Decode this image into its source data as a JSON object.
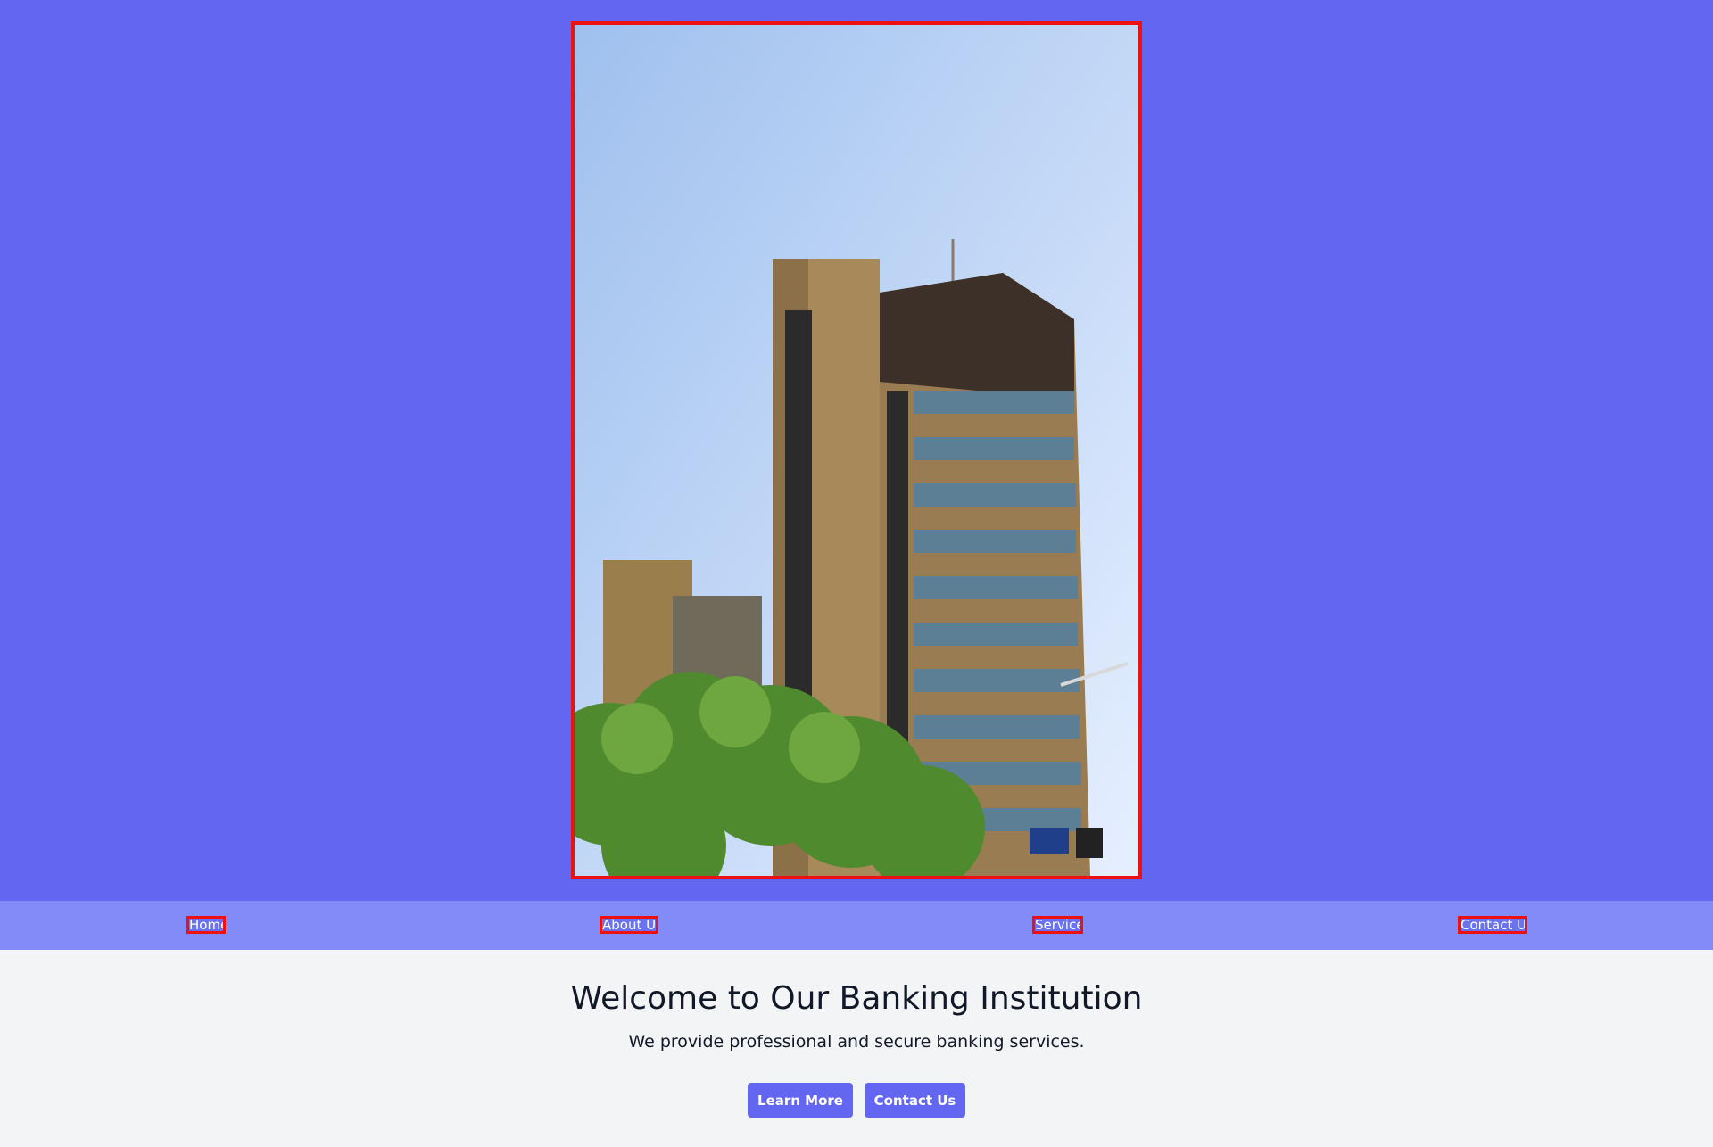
{
  "hero": {
    "image_alt": "Bank headquarters building"
  },
  "nav": {
    "items": [
      {
        "label": "Home"
      },
      {
        "label": "About Us"
      },
      {
        "label": "Services"
      },
      {
        "label": "Contact Us"
      }
    ]
  },
  "main": {
    "title": "Welcome to Our Banking Institution",
    "subtitle": "We provide professional and secure banking services.",
    "buttons": {
      "learn_more": "Learn More",
      "contact_us": "Contact Us"
    }
  },
  "colors": {
    "hero_bg": "#6366f1",
    "nav_bg": "#818cf8",
    "page_bg": "#f3f4f6",
    "button_bg": "#6366f1",
    "outline": "#ee1111"
  }
}
